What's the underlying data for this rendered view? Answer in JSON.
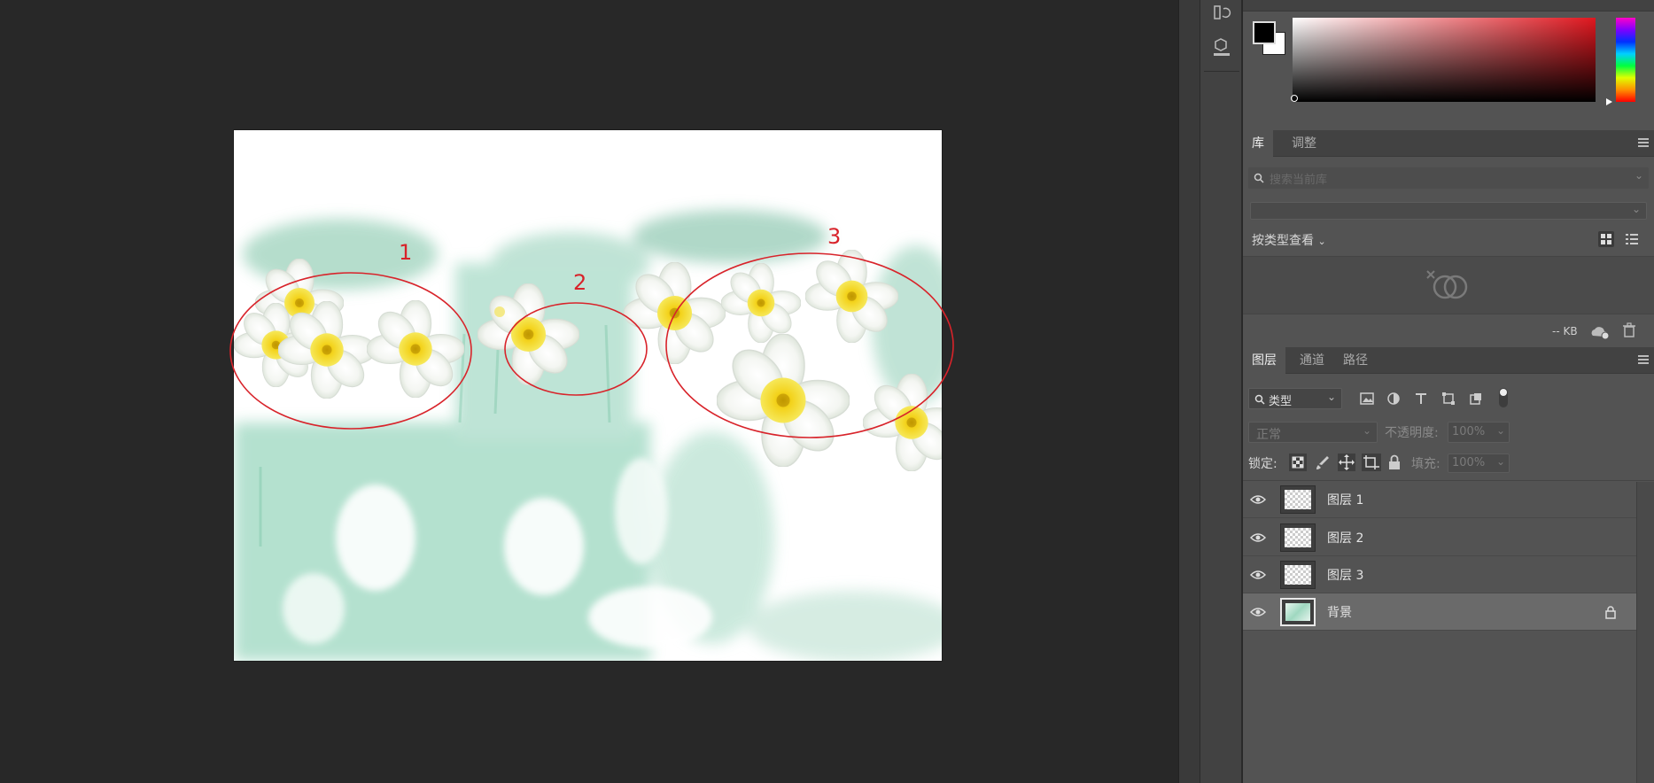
{
  "canvas": {
    "annotations": [
      "1",
      "2",
      "3"
    ]
  },
  "libraries_panel": {
    "tabs": [
      "库",
      "调整"
    ],
    "search_placeholder": "搜索当前库",
    "view_by_label": "按类型查看",
    "storage_label": "-- KB"
  },
  "layers_panel": {
    "tabs": [
      "图层",
      "通道",
      "路径"
    ],
    "filter_label": "类型",
    "blend_mode": "正常",
    "opacity_label": "不透明度:",
    "opacity_value": "100%",
    "lock_label": "锁定:",
    "fill_label": "填充:",
    "fill_value": "100%",
    "layers": [
      {
        "name": "图层 1",
        "visible": true,
        "locked": false
      },
      {
        "name": "图层 2",
        "visible": true,
        "locked": false
      },
      {
        "name": "图层 3",
        "visible": true,
        "locked": false
      },
      {
        "name": "背景",
        "visible": true,
        "locked": true
      }
    ]
  },
  "colors": {
    "foreground": "#000000",
    "background": "#ffffff",
    "annotation": "#d8232a"
  }
}
